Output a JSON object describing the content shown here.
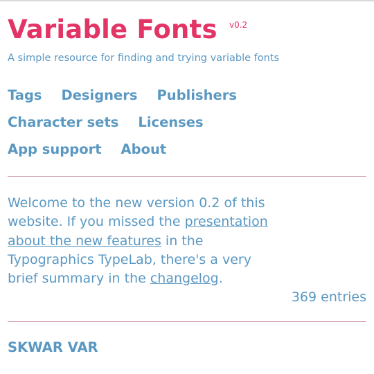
{
  "header": {
    "title": "Variable Fonts",
    "version": "v0.2",
    "tagline": "A simple resource for finding and trying variable fonts"
  },
  "nav": {
    "rows": [
      [
        "Tags",
        "Designers",
        "Publishers"
      ],
      [
        "Character sets",
        "Licenses"
      ],
      [
        "App support",
        "About"
      ]
    ]
  },
  "intro": {
    "text_1": "Welcome to the new version 0.2 of this website. If you missed the ",
    "link_1": "presentation about the new features",
    "text_2": " in the Typographics TypeLab, there's a very brief summary in the ",
    "link_2": "changelog",
    "text_3": "."
  },
  "entries": "369 entries",
  "first_font": "SKWAR VAR",
  "colors": {
    "brand": "#e33466",
    "link": "#5a98c2",
    "rule": "#c98aa0"
  }
}
